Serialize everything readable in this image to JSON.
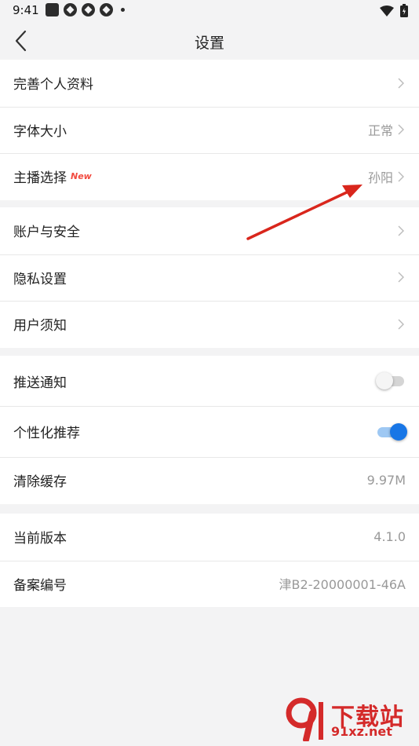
{
  "status_bar": {
    "time": "9:41"
  },
  "header": {
    "title": "设置"
  },
  "group1": {
    "profile_label": "完善个人资料",
    "font_size_label": "字体大小",
    "font_size_value": "正常",
    "anchor_label": "主播选择",
    "anchor_badge": "New",
    "anchor_value": "孙阳"
  },
  "group2": {
    "account_label": "账户与安全",
    "privacy_label": "隐私设置",
    "notice_label": "用户须知"
  },
  "group3": {
    "push_label": "推送通知",
    "push_enabled": false,
    "recommend_label": "个性化推荐",
    "recommend_enabled": true,
    "cache_label": "清除缓存",
    "cache_value": "9.97M"
  },
  "group4": {
    "version_label": "当前版本",
    "version_value": "4.1.0",
    "icp_label": "备案编号",
    "icp_value": "津B2-20000001-46A"
  },
  "watermark": {
    "brand": "下载站",
    "url": "91xz.net"
  },
  "colors": {
    "accent": "#1876e6",
    "badge": "#f24a3f",
    "arrow": "#d9261c",
    "watermark": "#d42a2a"
  }
}
